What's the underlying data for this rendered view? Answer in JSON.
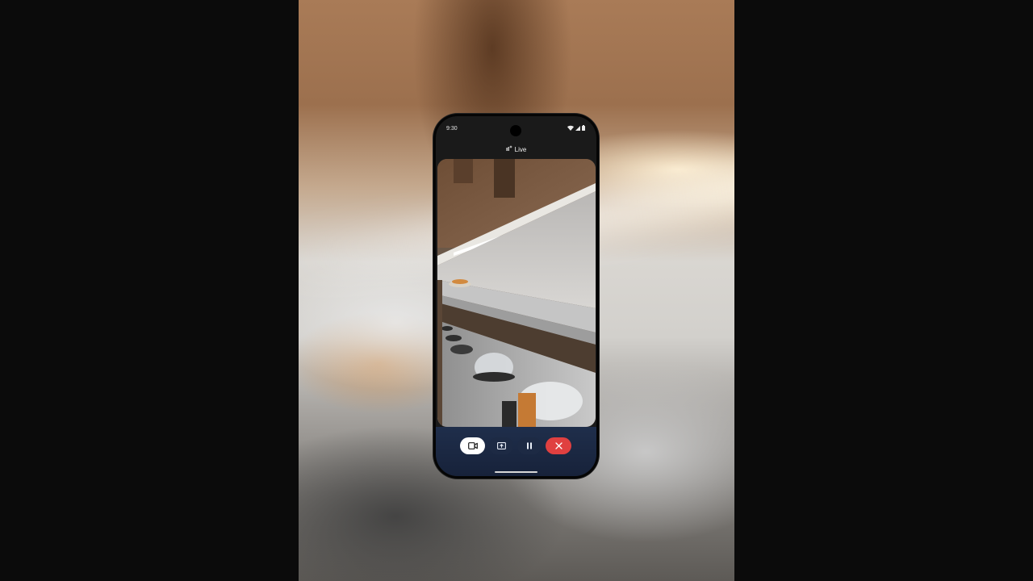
{
  "status_bar": {
    "time": "9:30",
    "icons": [
      "wifi-icon",
      "cellular-signal-icon",
      "battery-icon"
    ]
  },
  "header": {
    "icon": "live-sparkle-icon",
    "label": "Live"
  },
  "video_feed": {
    "description_icon": "camera-preview"
  },
  "controls": {
    "camera": {
      "icon": "video-camera-icon",
      "active": true
    },
    "share_screen": {
      "icon": "screen-share-icon"
    },
    "pause": {
      "icon": "pause-icon"
    },
    "end": {
      "icon": "close-icon",
      "color": "#e04040"
    }
  },
  "colors": {
    "controls_background": "#1f2e4b",
    "end_button": "#e04040",
    "active_button": "#ffffff"
  }
}
